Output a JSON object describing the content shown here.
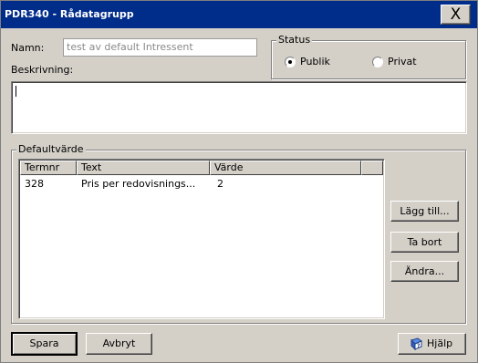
{
  "window": {
    "title": "PDR340 - Rådatagrupp",
    "close_symbol": "X"
  },
  "form": {
    "name_label": "Namn:",
    "name_value": "test av default Intressent",
    "description_label": "Beskrivning:",
    "description_value": ""
  },
  "status": {
    "legend": "Status",
    "options": [
      {
        "label": "Publik",
        "selected": true
      },
      {
        "label": "Privat",
        "selected": false
      }
    ]
  },
  "defaults": {
    "legend": "Defaultvärde",
    "columns": [
      "Termnr",
      "Text",
      "Värde"
    ],
    "rows": [
      {
        "termnr": "328",
        "text": "Pris per redovisnings...",
        "varde": "2"
      }
    ]
  },
  "side_buttons": {
    "add": "Lägg till...",
    "remove": "Ta bort",
    "edit": "Ändra..."
  },
  "bottom_buttons": {
    "save": "Spara",
    "cancel": "Avbryt",
    "help": "Hjälp",
    "help_icon": "help-book-icon"
  }
}
